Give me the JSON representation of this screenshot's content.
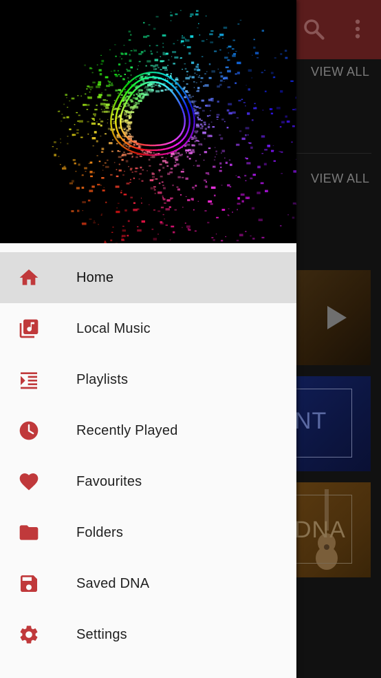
{
  "colors": {
    "accent": "#c0393b",
    "drawer_background": "#fafafa",
    "active_item_background": "#dddddd",
    "toolbar": "#5a1c1c"
  },
  "background": {
    "view_all_1": "VIEW ALL",
    "view_all_2": "VIEW ALL",
    "card_2_text": "NT",
    "card_3_text": "DNA",
    "icons": [
      "search-icon",
      "more-vert-icon",
      "play-icon"
    ]
  },
  "drawer": {
    "menu": [
      {
        "label": "Home",
        "icon": "home-icon",
        "active": true
      },
      {
        "label": "Local Music",
        "icon": "library-music-icon",
        "active": false
      },
      {
        "label": "Playlists",
        "icon": "playlist-icon",
        "active": false
      },
      {
        "label": "Recently Played",
        "icon": "clock-icon",
        "active": false
      },
      {
        "label": "Favourites",
        "icon": "heart-icon",
        "active": false
      },
      {
        "label": "Folders",
        "icon": "folder-icon",
        "active": false
      },
      {
        "label": "Saved DNA",
        "icon": "save-icon",
        "active": false
      },
      {
        "label": "Settings",
        "icon": "gear-icon",
        "active": false
      }
    ]
  }
}
